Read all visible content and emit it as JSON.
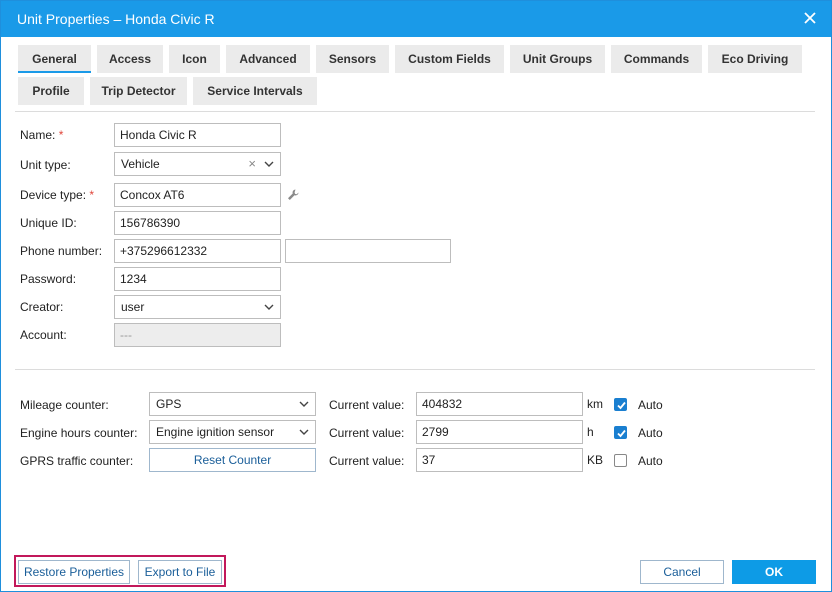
{
  "window": {
    "title": "Unit Properties – Honda Civic R"
  },
  "tabs": [
    {
      "label": "General"
    },
    {
      "label": "Access"
    },
    {
      "label": "Icon"
    },
    {
      "label": "Advanced"
    },
    {
      "label": "Sensors"
    },
    {
      "label": "Custom Fields"
    },
    {
      "label": "Unit Groups"
    },
    {
      "label": "Commands"
    },
    {
      "label": "Eco Driving"
    },
    {
      "label": "Profile"
    },
    {
      "label": "Trip Detector"
    },
    {
      "label": "Service Intervals"
    }
  ],
  "general": {
    "name": {
      "label": "Name:",
      "required": "*",
      "value": "Honda Civic R"
    },
    "unit_type": {
      "label": "Unit type:",
      "value": "Vehicle"
    },
    "device_type": {
      "label": "Device type:",
      "required": "*",
      "value": "Concox AT6"
    },
    "unique_id": {
      "label": "Unique ID:",
      "value": "156786390"
    },
    "phone": {
      "label": "Phone number:",
      "value": "+375296612332",
      "value2": ""
    },
    "password": {
      "label": "Password:",
      "value": "1234"
    },
    "creator": {
      "label": "Creator:",
      "value": "user"
    },
    "account": {
      "label": "Account:",
      "value": "---"
    }
  },
  "counters": {
    "current_value_label": "Current value:",
    "auto_label": "Auto",
    "mileage": {
      "label": "Mileage counter:",
      "select": "GPS",
      "value": "404832",
      "unit": "km",
      "auto": true
    },
    "engine": {
      "label": "Engine hours counter:",
      "select": "Engine ignition sensor",
      "value": "2799",
      "unit": "h",
      "auto": true
    },
    "gprs": {
      "label": "GPRS traffic counter:",
      "button": "Reset Counter",
      "value": "37",
      "unit": "KB",
      "auto": false
    }
  },
  "footer": {
    "restore": "Restore Properties",
    "export": "Export to File",
    "cancel": "Cancel",
    "ok": "OK"
  },
  "colors": {
    "accent": "#1a9ae8",
    "highlight": "#c2185b"
  }
}
